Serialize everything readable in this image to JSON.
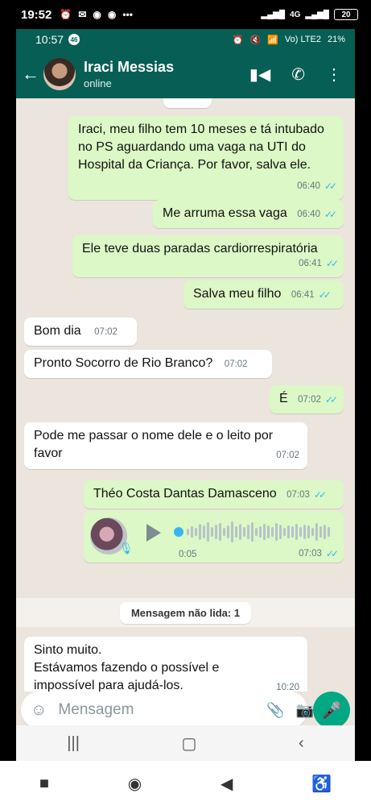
{
  "outer_status": {
    "time": "19:52",
    "battery": "20",
    "network": "4G"
  },
  "inner_status": {
    "time": "10:57",
    "badge": "46",
    "battery": "21%",
    "network": "Vo) LTE2"
  },
  "header": {
    "contact_name": "Iraci Messias",
    "status": "online"
  },
  "messages": [
    {
      "dir": "out",
      "text": "Iraci, meu filho tem 10 meses e tá intubado no PS aguardando uma vaga na UTI do Hospital da Criança. Por favor, salva ele.",
      "time": "06:40"
    },
    {
      "dir": "out",
      "text": "Me arruma essa vaga",
      "time": "06:40"
    },
    {
      "dir": "out",
      "text": "Ele teve duas paradas cardiorrespiratória",
      "time": "06:41"
    },
    {
      "dir": "out",
      "text": "Salva meu filho",
      "time": "06:41"
    },
    {
      "dir": "in",
      "text": "Bom dia",
      "time": "07:02"
    },
    {
      "dir": "in",
      "text": "Pronto Socorro de Rio Branco?",
      "time": "07:02"
    },
    {
      "dir": "out",
      "text": "É",
      "time": "07:02"
    },
    {
      "dir": "in",
      "text": "Pode me passar o nome dele e o leito por favor",
      "time": "07:02"
    },
    {
      "dir": "out",
      "text": "Théo Costa Dantas Damasceno",
      "time": "07:03"
    },
    {
      "dir": "in",
      "text": "Sinto muito.\nEstávamos fazendo o possível e impossível para ajudá-los.",
      "time": "10:20"
    }
  ],
  "audio": {
    "duration": "0:05",
    "time": "07:03"
  },
  "unread_label": "Mensagem não lida: 1",
  "composer": {
    "placeholder": "Mensagem"
  },
  "colors": {
    "header": "#075e54",
    "outgoing_bubble": "#dcf8c6",
    "incoming_bubble": "#ffffff",
    "mic_button": "#00a884",
    "read_ticks": "#34b7f1"
  }
}
